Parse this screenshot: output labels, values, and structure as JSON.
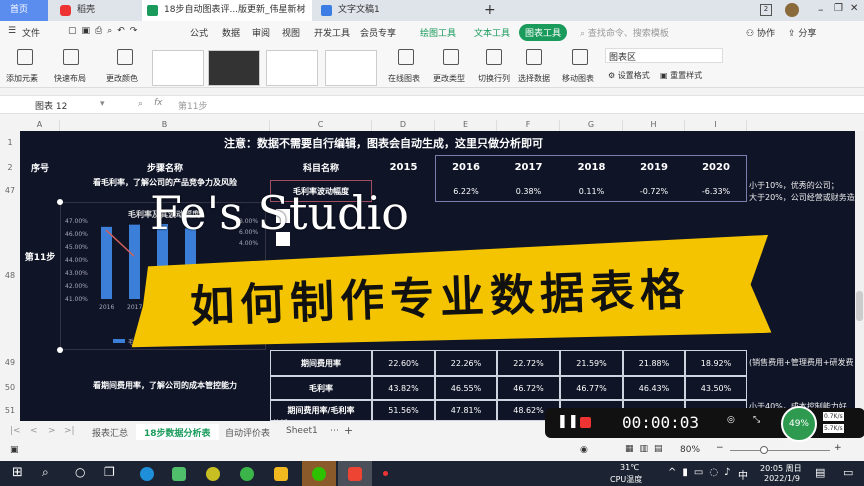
{
  "tabs": [
    {
      "label": "首页"
    },
    {
      "label": "稻壳"
    },
    {
      "label": "18步自动图表评...版更新_伟星新材"
    },
    {
      "label": "文字文稿1"
    }
  ],
  "menu": {
    "file": "文件",
    "items": [
      "公式",
      "数据",
      "审阅",
      "视图",
      "开发工具",
      "会员专享"
    ],
    "draw_tools": "绘图工具",
    "text_tools": "文本工具",
    "chart_tools": "图表工具",
    "search_placeholder": "查找命令、搜索模板",
    "collab": "协作",
    "share": "分享"
  },
  "ribbon": {
    "add_element": "添加元素",
    "quick_layout": "快速布局",
    "change_color": "更改颜色",
    "online_chart": "在线图表",
    "change_type": "更改类型",
    "switch_rowcol": "切换行列",
    "select_data": "选择数据",
    "move_chart": "移动图表",
    "chart_area": "图表区",
    "set_format": "设置格式",
    "reset_style": "重置样式"
  },
  "formula": {
    "name_box": "图表 12",
    "fx": "fx",
    "content": "第11步"
  },
  "columns": [
    "A",
    "B",
    "C",
    "D",
    "E",
    "F",
    "G",
    "H",
    "I"
  ],
  "rows": [
    "1",
    "2",
    "47",
    "48",
    "49",
    "50",
    "51"
  ],
  "sheet": {
    "title": "注意：数据不需要自行编辑，图表会自动生成，这里只做分析即可",
    "headers": [
      "序号",
      "步骤名称",
      "科目名称",
      "2015",
      "2016",
      "2017",
      "2018",
      "2019",
      "2020"
    ],
    "row47": {
      "step_text": "看毛利率，了解公司的产品竞争力及风险",
      "subject": "毛利率波动幅度",
      "values": [
        "6.22%",
        "0.38%",
        "0.11%",
        "-0.72%",
        "-6.33%"
      ],
      "note1": "小于10%，优秀的公司；",
      "note2": "大于20%，公司经营或财务造"
    },
    "row48": {
      "step": "第11步"
    },
    "row49_51_step": "看期间费用率，了解公司的成本管控能力",
    "table": [
      {
        "subject": "期间费用率",
        "values": [
          "22.60%",
          "22.26%",
          "22.72%",
          "21.59%",
          "21.88%",
          "18.92%"
        ],
        "note": "(销售费用+管理费用+研发费"
      },
      {
        "subject": "毛利率",
        "values": [
          "43.82%",
          "46.55%",
          "46.72%",
          "46.77%",
          "46.43%",
          "43.50%"
        ],
        "note": ""
      },
      {
        "subject": "期间费用率/毛利率",
        "values": [
          "51.56%",
          "47.81%",
          "48.62%",
          "",
          "",
          ""
        ],
        "note": "小于40%，成本控制能力好,"
      }
    ],
    "analysis": "分析:"
  },
  "chart": {
    "title": "毛利率及其波动幅度",
    "left_ticks": [
      "47.00%",
      "46.00%",
      "45.00%",
      "44.00%",
      "43.00%",
      "42.00%",
      "41.00%"
    ],
    "right_ticks": [
      "8.00%",
      "6.00%",
      "4.00%"
    ],
    "categories": [
      "2016",
      "2017"
    ],
    "legend": "毛利率",
    "bars": [
      46.55,
      46.72,
      46.77,
      46.43
    ],
    "ylim": [
      41,
      47
    ]
  },
  "overlay": {
    "watermark": "Fe's Studio",
    "banner": "如何制作专业数据表格",
    "banner_color": "#f5c400"
  },
  "sheet_tabs": [
    "报表汇总",
    "18步数据分析表",
    "自动评价表",
    "Sheet1"
  ],
  "status": {
    "zoom": "80%"
  },
  "recorder": {
    "time": "00:00:03",
    "cpu": "49%",
    "up": "0.7K/s",
    "down": "5.7K/s"
  },
  "taskbar": {
    "temp": "31℃",
    "temp_label": "CPU温度",
    "time": "20:05 周日",
    "date": "2022/1/9",
    "ime": "中"
  }
}
